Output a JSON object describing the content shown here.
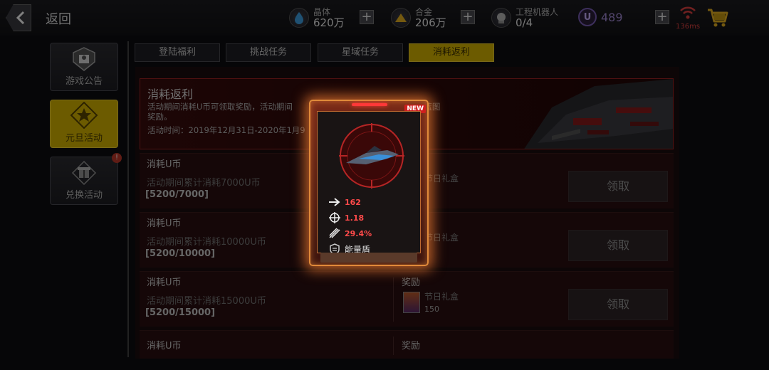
{
  "header": {
    "back_label": "返回",
    "resources": [
      {
        "name": "晶体",
        "value": "620万",
        "icon": "crystal-icon"
      },
      {
        "name": "合金",
        "value": "206万",
        "icon": "alloy-icon"
      },
      {
        "name": "工程机器人",
        "value": "0/4",
        "icon": "robot-icon"
      }
    ],
    "ucoin_symbol": "U",
    "ucoin_value": "489",
    "ping": "136ms",
    "ping_color": "#e04040"
  },
  "sidebar": {
    "items": [
      {
        "label": "游戏公告",
        "icon": "announcement-icon",
        "active": false
      },
      {
        "label": "元旦活动",
        "icon": "event-star-icon",
        "active": true
      },
      {
        "label": "兑换活动",
        "icon": "gift-icon",
        "active": false,
        "badge": "!"
      }
    ]
  },
  "tabs": [
    {
      "label": "登陆福利",
      "active": false
    },
    {
      "label": "挑战任务",
      "active": false
    },
    {
      "label": "星域任务",
      "active": false
    },
    {
      "label": "消耗返利",
      "active": true
    }
  ],
  "banner": {
    "title": "消耗返利",
    "desc_left": "活动期间消耗U币可领取奖励，活动期间",
    "desc_right": "可领取蓝图",
    "desc_line2": "奖励。",
    "time": "活动时间：2019年12月31日-2020年1月9"
  },
  "rows": [
    {
      "title": "消耗U币",
      "desc": "活动期间累计消耗7000U币",
      "progress": "[5200/7000]",
      "reward_head": "",
      "reward_name": "节日礼盒",
      "reward_count": "",
      "button": "领取"
    },
    {
      "title": "消耗U币",
      "desc": "活动期间累计消耗10000U币",
      "progress": "[5200/10000]",
      "reward_head": "",
      "reward_name": "节日礼盒",
      "reward_count": "",
      "button": "领取"
    },
    {
      "title": "消耗U币",
      "desc": "活动期间累计消耗15000U币",
      "progress": "[5200/15000]",
      "reward_head": "奖励",
      "reward_name": "节日礼盒",
      "reward_count": "150",
      "button": "领取"
    },
    {
      "title": "消耗U币",
      "desc": "",
      "progress": "",
      "reward_head": "奖励",
      "reward_name": "",
      "reward_count": "",
      "button": ""
    }
  ],
  "card": {
    "badge": "NEW",
    "stats": [
      {
        "icon": "speed-arrow-icon",
        "value": "162"
      },
      {
        "icon": "crosshair-icon",
        "value": "1.18"
      },
      {
        "icon": "missile-icon",
        "value": "29.4%"
      },
      {
        "icon": "shield-icon",
        "value": "能量盾"
      }
    ]
  },
  "colors": {
    "accent_yellow": "#d9b600",
    "card_glow": "#e08a3a",
    "banner_red": "#a02222",
    "stat_red": "#ff4a4a"
  }
}
